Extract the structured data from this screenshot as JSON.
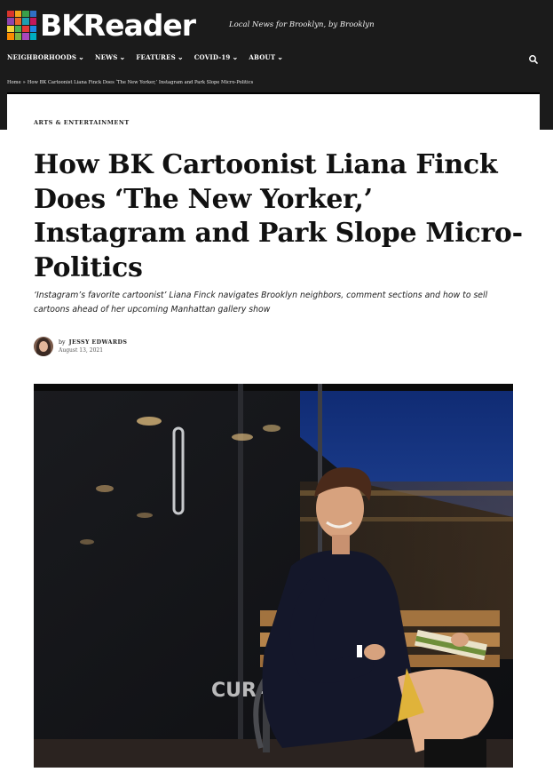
{
  "site": {
    "logo_text": "BKReader",
    "tagline": "Local News for Brooklyn, by Brooklyn",
    "logo_colors": [
      "#d9352b",
      "#f2a51a",
      "#3aa04a",
      "#2f6fc4",
      "#8e44ad",
      "#e8662a",
      "#1f9fb0",
      "#c2185b",
      "#f5d33a",
      "#4caf50",
      "#e53935",
      "#1e88e5",
      "#fb8c00",
      "#7cb342",
      "#ab47bc",
      "#00acc1"
    ]
  },
  "nav": {
    "items": [
      {
        "label": "NEIGHBORHOODS"
      },
      {
        "label": "NEWS"
      },
      {
        "label": "FEATURES"
      },
      {
        "label": "COVID-19"
      },
      {
        "label": "ABOUT"
      }
    ],
    "chevron": "chevron-down-icon",
    "search_icon": "search-icon"
  },
  "breadcrumb": {
    "home": "Home",
    "separator": "»",
    "current": "How BK Cartoonist Liana Finck Does ‘The New Yorker,’ Instagram and Park Slope Micro-Politics"
  },
  "article": {
    "category": "ARTS & ENTERTAINMENT",
    "title": "How BK Cartoonist Liana Finck Does ‘The New Yorker,’ Instagram and Park Slope Micro-Politics",
    "subtitle": "‘Instagram’s favorite cartoonist’ Liana Finck navigates Brooklyn neighbors, comment sections and how to sell cartoons ahead of her upcoming Manhattan gallery show",
    "by_prefix": "by",
    "author": "JESSY EDWARDS",
    "date": "August 13, 2021"
  },
  "photo": {
    "window_text": "CURA"
  },
  "colors": {
    "header_bg": "#1b1b1b",
    "text_dark": "#111111"
  }
}
